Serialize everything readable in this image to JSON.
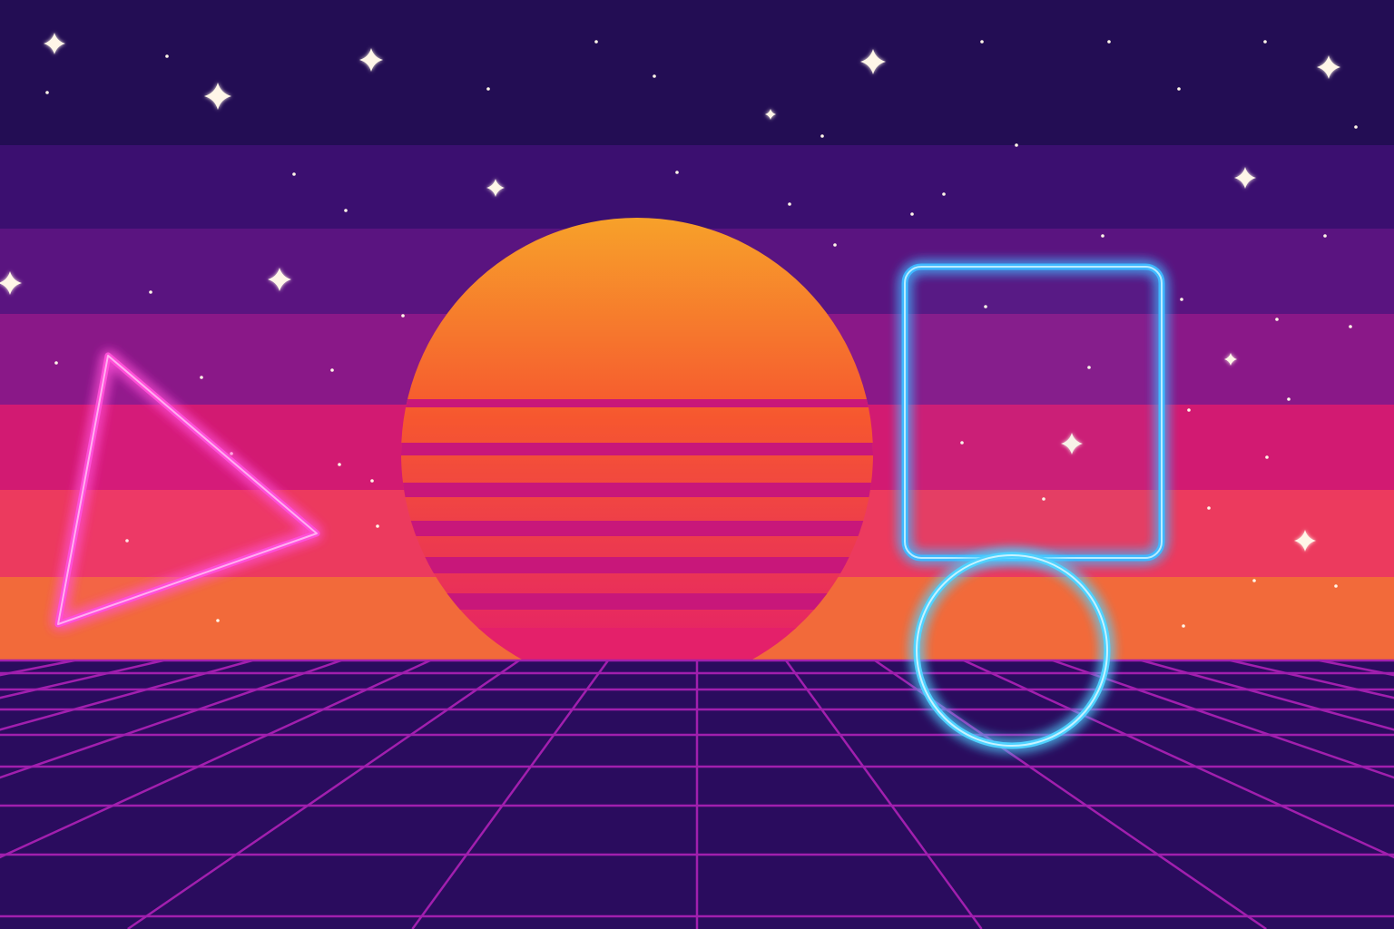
{
  "scene": {
    "description_free": true,
    "colors": {
      "sky_bands": [
        "#230d54",
        "#3b0f70",
        "#5a1480",
        "#8a1888",
        "#d21a72",
        "#ec3a5e",
        "#f26a3a"
      ],
      "sun_top": "#f7a12a",
      "sun_mid": "#f6572f",
      "sun_bottom": "#e4206a",
      "sun_stripe_gap": "#c8177a",
      "floor": "#2a0c5e",
      "grid_line": "#a11fae",
      "triangle_neon": "#ff4fd8",
      "triangle_glow": "#ff2fc8",
      "square_neon": "#3fb8ff",
      "circle_neon": "#4fd2ff",
      "star": "#fff6e8"
    },
    "icons": [
      "sun-shape",
      "neon-triangle",
      "neon-rounded-square",
      "neon-circle",
      "star-sparkle",
      "perspective-grid"
    ]
  }
}
